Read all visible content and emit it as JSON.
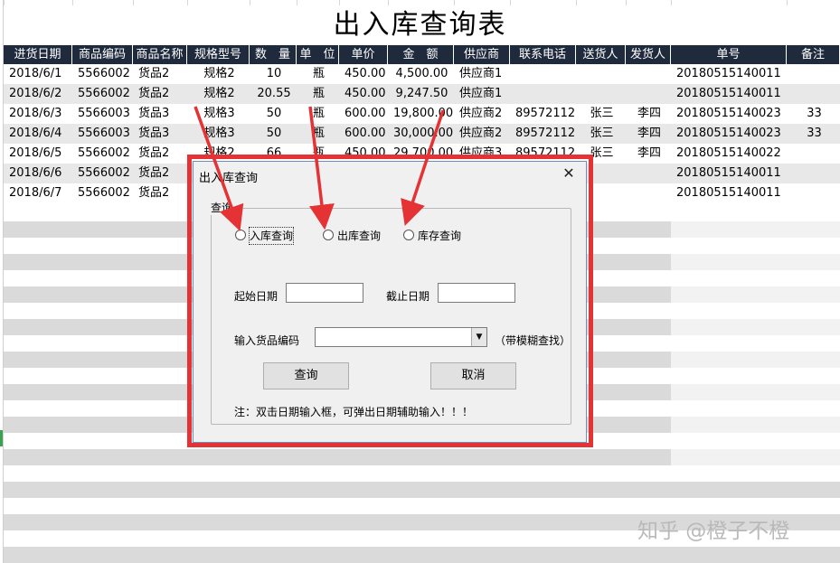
{
  "sheet": {
    "title": "出入库查询表",
    "headers": [
      "进货日期",
      "商品编码",
      "商品名称",
      "规格型号",
      "数　量",
      "单　位",
      "单价",
      "金　额",
      "供应商",
      "联系电话",
      "送货人",
      "发货人",
      "单号",
      "备注"
    ],
    "rows": [
      [
        "2018/6/1",
        "5566002",
        "货品2",
        "规格2",
        "10",
        "瓶",
        "450.00",
        "4,500.00",
        "供应商1",
        "",
        "",
        "",
        "20180515140011",
        ""
      ],
      [
        "2018/6/2",
        "5566002",
        "货品2",
        "规格2",
        "20.55",
        "瓶",
        "450.00",
        "9,247.50",
        "供应商1",
        "",
        "",
        "",
        "20180515140011",
        ""
      ],
      [
        "2018/6/3",
        "5566003",
        "货品3",
        "规格3",
        "50",
        "瓶",
        "600.00",
        "19,800.00",
        "供应商2",
        "89572112",
        "张三",
        "李四",
        "20180515140023",
        "33"
      ],
      [
        "2018/6/4",
        "5566003",
        "货品3",
        "规格3",
        "50",
        "瓶",
        "600.00",
        "30,000.00",
        "供应商2",
        "89572112",
        "张三",
        "李四",
        "20180515140023",
        "33"
      ],
      [
        "2018/6/5",
        "5566002",
        "货品2",
        "规格2",
        "66",
        "瓶",
        "450.00",
        "29,700.00",
        "供应商3",
        "89572112",
        "张三",
        "李四",
        "20180515140022",
        ""
      ],
      [
        "2018/6/6",
        "5566002",
        "货品2",
        "",
        "",
        "",
        "",
        "",
        "",
        "",
        "",
        "",
        "20180515140011",
        ""
      ],
      [
        "2018/6/7",
        "5566002",
        "货品2",
        "",
        "",
        "",
        "",
        "",
        "",
        "",
        "",
        "",
        "20180515140011",
        ""
      ]
    ]
  },
  "dialog": {
    "title": "出入库查询",
    "close_label": "✕",
    "group_label": "查询",
    "radios": [
      {
        "label": "入库查询",
        "checked": false
      },
      {
        "label": "出库查询",
        "checked": false
      },
      {
        "label": "库存查询",
        "checked": false
      }
    ],
    "start_date_label": "起始日期",
    "start_date_value": "",
    "end_date_label": "截止日期",
    "end_date_value": "",
    "code_label": "输入货品编码",
    "code_value": "",
    "code_hint": "（带模糊查找）",
    "combo_arrow": "▼",
    "query_button": "查询",
    "cancel_button": "取消",
    "note": "注：双击日期输入框，可弹出日期辅助输入！！！"
  },
  "annotation": {
    "highlight_color": "#e53335"
  },
  "watermark": "知乎 @橙子不橙"
}
